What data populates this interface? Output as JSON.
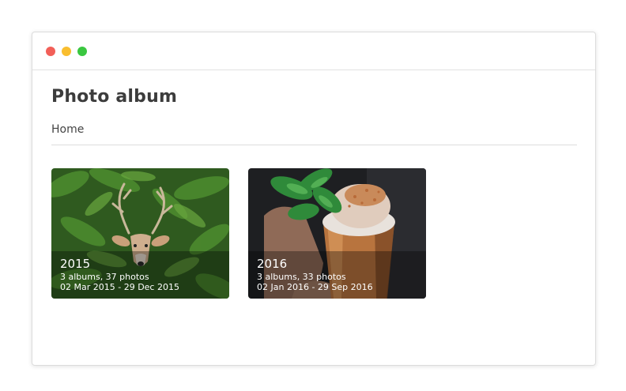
{
  "window": {
    "controls": [
      "close",
      "minimize",
      "maximize"
    ]
  },
  "page": {
    "title": "Photo album"
  },
  "breadcrumb": {
    "home": "Home"
  },
  "albums": [
    {
      "year": "2015",
      "count": "3 albums, 37 photos",
      "range": "02 Mar 2015 - 29 Dec 2015",
      "image": "deer-in-ferns"
    },
    {
      "year": "2016",
      "count": "3 albums, 33 photos",
      "range": "02 Jan 2016 - 29 Sep 2016",
      "image": "copper-cup-cocktail-with-mint"
    }
  ],
  "colors": {
    "close": "#f25f58",
    "minimize": "#f9be2f",
    "maximize": "#3ac740",
    "title": "#3c3c3c"
  }
}
